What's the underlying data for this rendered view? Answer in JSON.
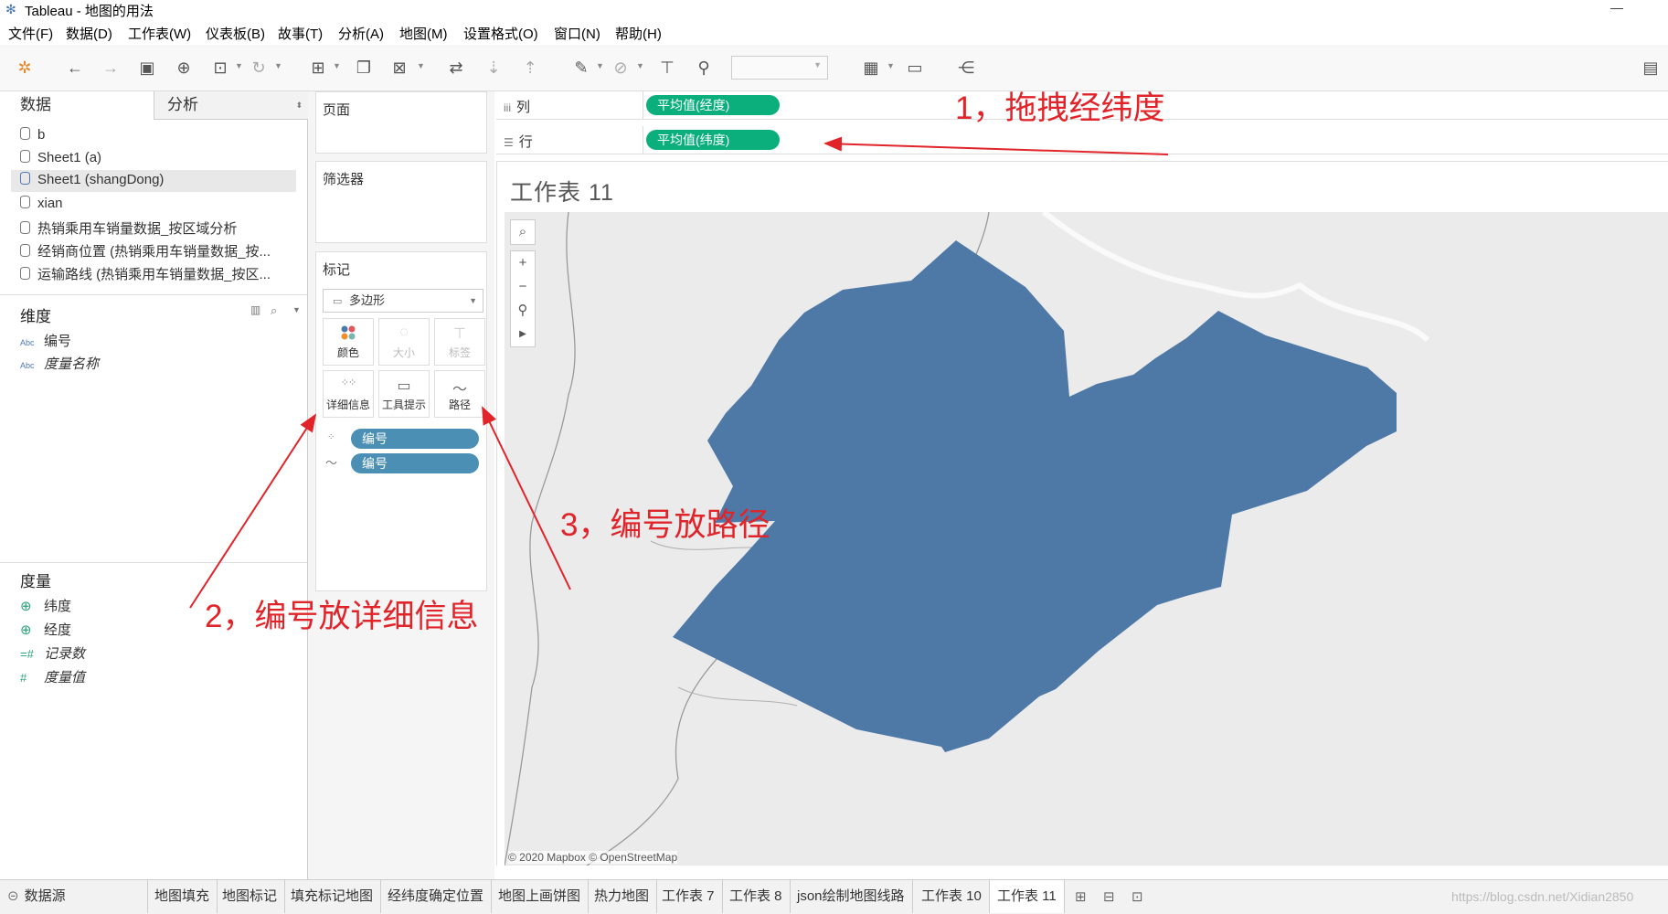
{
  "window": {
    "title": "Tableau - 地图的用法"
  },
  "menu": [
    "文件(F)",
    "数据(D)",
    "工作表(W)",
    "仪表板(B)",
    "故事(T)",
    "分析(A)",
    "地图(M)",
    "设置格式(O)",
    "窗口(N)",
    "帮助(H)"
  ],
  "left": {
    "tab_data": "数据",
    "tab_analysis": "分析",
    "datasources": [
      "b",
      "Sheet1 (a)",
      "Sheet1 (shangDong)",
      "xian",
      "热销乘用车销量数据_按区域分析",
      "经销商位置 (热销乘用车销量数据_按...",
      "运输路线 (热销乘用车销量数据_按区..."
    ],
    "dimensions_title": "维度",
    "dimensions": [
      {
        "icon": "Abc",
        "label": "编号"
      },
      {
        "icon": "Abc",
        "label": "度量名称"
      }
    ],
    "measures_title": "度量",
    "measures": [
      {
        "icon": "globe",
        "label": "纬度"
      },
      {
        "icon": "globe",
        "label": "经度"
      },
      {
        "icon": "#",
        "label": "记录数"
      },
      {
        "icon": "#",
        "label": "度量值"
      }
    ]
  },
  "middle": {
    "pages_title": "页面",
    "filters_title": "筛选器",
    "marks_title": "标记",
    "mark_type": "多边形",
    "mark_buttons": [
      "颜色",
      "大小",
      "标签",
      "详细信息",
      "工具提示",
      "路径"
    ],
    "mark_pills": [
      "编号",
      "编号"
    ]
  },
  "shelves": {
    "columns_label": "列",
    "columns_pill": "平均值(经度)",
    "rows_label": "行",
    "rows_pill": "平均值(纬度)"
  },
  "view": {
    "sheet_title": "工作表 11",
    "attribution": "© 2020 Mapbox © OpenStreetMap",
    "polygon_color": "#4e79a7"
  },
  "annotations": {
    "a1": "1，拖拽经纬度",
    "a2": "2，编号放详细信息",
    "a3": "3，编号放路径",
    "color": "#e0242a"
  },
  "bottom_tabs": [
    "数据源",
    "地图填充",
    "地图标记",
    "填充标记地图",
    "经纬度确定位置",
    "地图上画饼图",
    "热力地图",
    "工作表 7",
    "工作表 8",
    "json绘制地图线路",
    "工作表 10",
    "工作表 11"
  ],
  "watermark": "https://blog.csdn.net/Xidian2850"
}
